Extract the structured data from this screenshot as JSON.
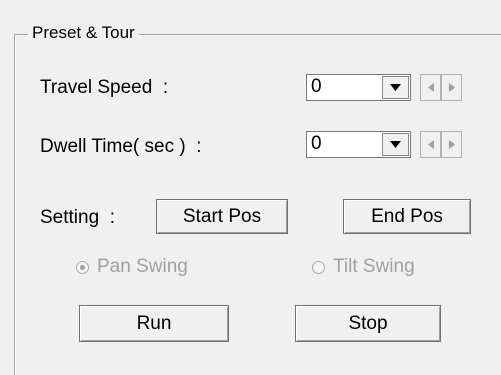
{
  "group": {
    "title": "Preset & Tour"
  },
  "travel_speed": {
    "label": "Travel Speed  :",
    "value": "0"
  },
  "dwell_time": {
    "label": "Dwell Time( sec )  :",
    "value": "0"
  },
  "setting": {
    "label": "Setting  :",
    "start_pos": "Start Pos",
    "end_pos": "End Pos"
  },
  "pan_swing": {
    "label": "Pan Swing",
    "checked": true,
    "enabled": false
  },
  "tilt_swing": {
    "label": "Tilt Swing",
    "checked": false,
    "enabled": false
  },
  "actions": {
    "run": "Run",
    "stop": "Stop"
  }
}
